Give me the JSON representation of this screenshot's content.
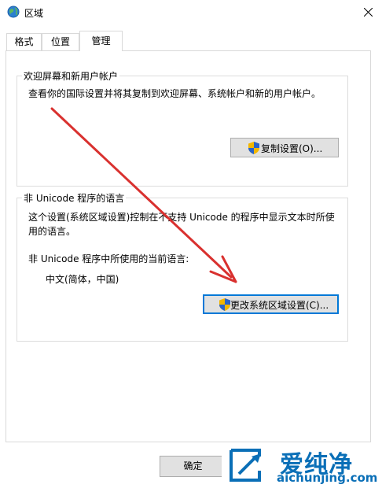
{
  "window": {
    "title": "区域"
  },
  "tabs": [
    {
      "label": "格式"
    },
    {
      "label": "位置"
    },
    {
      "label": "管理"
    }
  ],
  "welcome_group": {
    "title": "欢迎屏幕和新用户帐户",
    "description": "查看你的国际设置并将其复制到欢迎屏幕、系统帐户和新的用户帐户。",
    "copy_button": "复制设置(O)..."
  },
  "unicode_group": {
    "title": "非 Unicode 程序的语言",
    "description_line1": "这个设置(系统区域设置)控制在不支持 Unicode 的程序中显示文本时所使",
    "description_line2": "用的语言。",
    "current_label": "非 Unicode 程序中所使用的当前语言:",
    "current_value": "中文(简体，中国)",
    "change_button": "更改系统区域设置(C)..."
  },
  "footer": {
    "ok_button": "确定"
  },
  "watermark": {
    "brand": "爱纯净",
    "url": "aichunjing.com"
  },
  "colors": {
    "accent": "#0078d7",
    "arrow": "#d9312f",
    "watermark": "#0a6fb7"
  }
}
